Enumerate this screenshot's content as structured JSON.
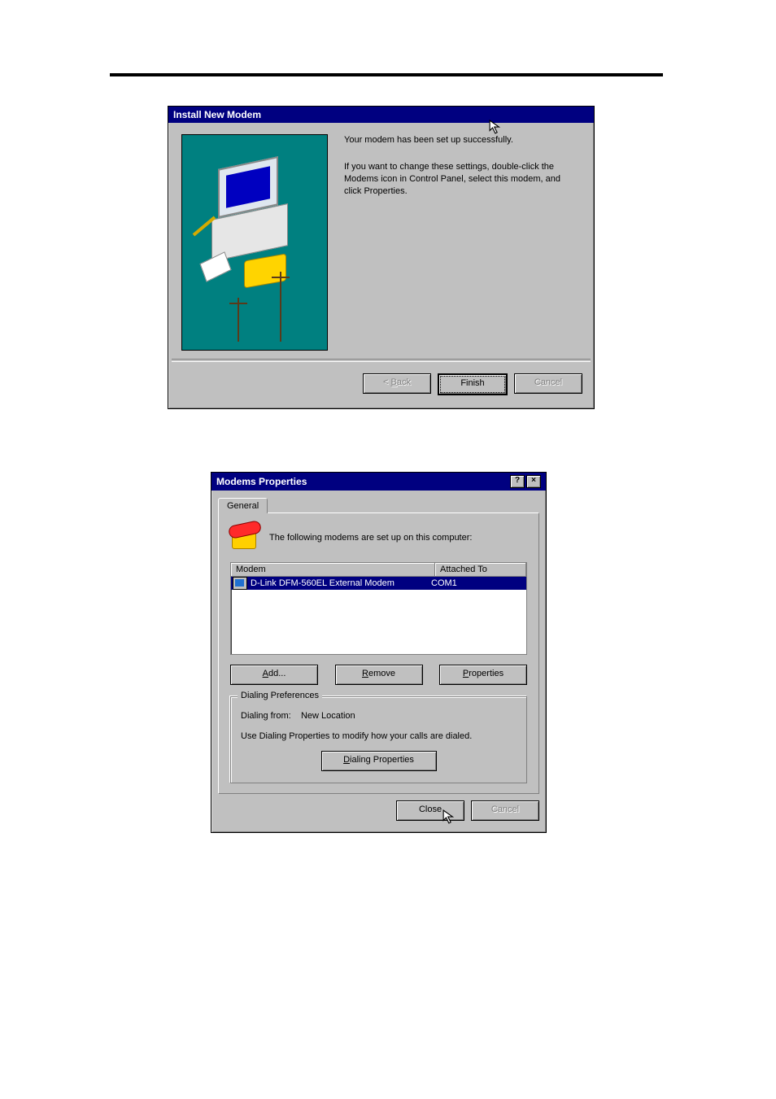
{
  "win1": {
    "title": "Install New Modem",
    "msg1": "Your modem has been set up successfully.",
    "msg2": "If you want to change these settings, double-click the Modems icon in Control Panel, select this modem, and click Properties.",
    "buttons": {
      "back": "< Back",
      "finish": "Finish",
      "cancel": "Cancel"
    }
  },
  "win2": {
    "title": "Modems Properties",
    "ctrl": {
      "help": "?",
      "close": "×"
    },
    "tabs": [
      "General"
    ],
    "header_text": "The following modems are set up on this computer:",
    "columns": [
      "Modem",
      "Attached To"
    ],
    "rows": [
      {
        "modem": "D-Link DFM-560EL External Modem",
        "port": "COM1"
      }
    ],
    "list_buttons": {
      "add": "Add...",
      "remove": "Remove",
      "properties": "Properties"
    },
    "group": {
      "title": "Dialing Preferences",
      "from_label": "Dialing from:",
      "from_value": "New Location",
      "hint": "Use Dialing Properties to modify how your calls are dialed.",
      "button": "Dialing Properties"
    },
    "buttons": {
      "close": "Close",
      "cancel": "Cancel"
    }
  },
  "colors": {
    "titlebar": "#000080",
    "surface": "#c0c0c0",
    "teal": "#008080",
    "highlight": "#000080",
    "disabled_text": "#808080"
  }
}
